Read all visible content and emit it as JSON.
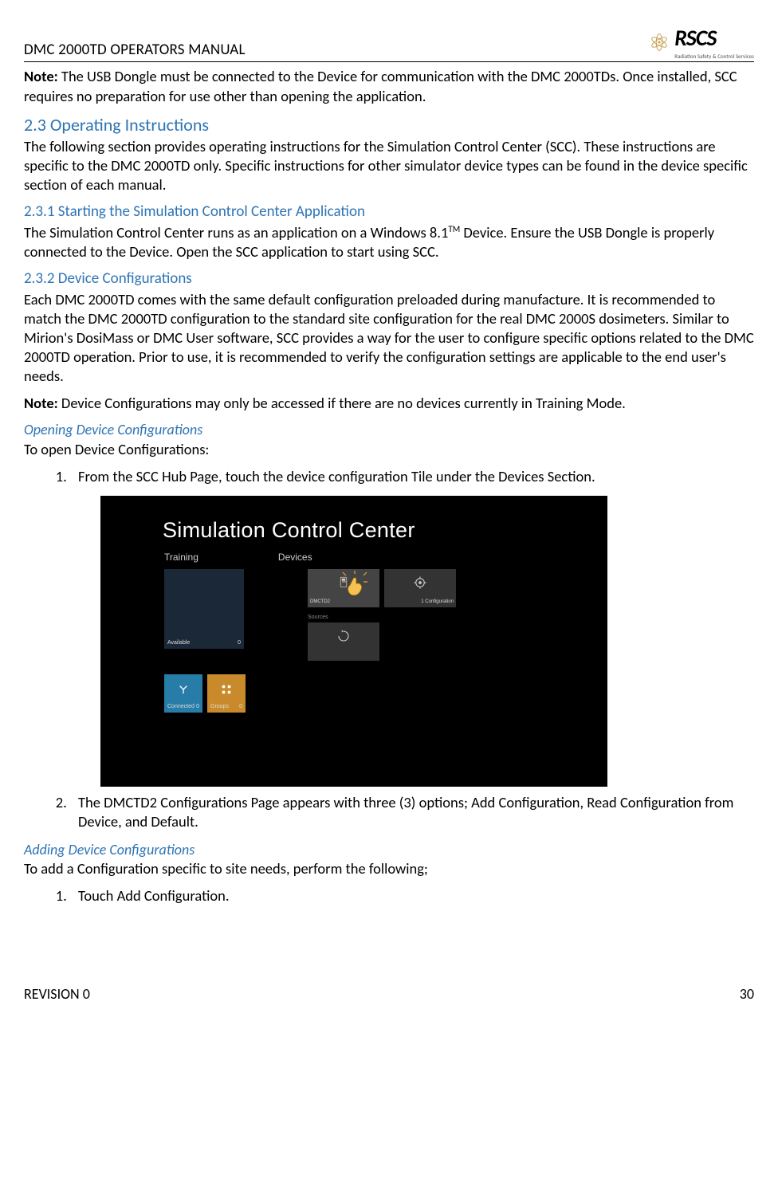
{
  "header": {
    "doc_title": "DMC 2000TD OPERATORS MANUAL",
    "logo_text": "RSCS",
    "logo_sub": "Radiation Safety & Control Services"
  },
  "body": {
    "note1_label": "Note:",
    "note1_text": " The USB Dongle must be connected to the Device for communication with the DMC 2000TDs. Once installed, SCC requires no preparation for use other than opening the application.",
    "h2_3": "2.3 Operating Instructions",
    "p2_3": "The following section provides operating instructions for the Simulation Control Center (SCC). These instructions are specific to the DMC 2000TD only. Specific instructions for other simulator device types can be found in the device specific section of each manual.",
    "h2_3_1": "2.3.1 Starting the Simulation Control Center Application",
    "p2_3_1a": "The Simulation Control Center runs as an application on a Windows 8.1",
    "p2_3_1_sup": "TM",
    "p2_3_1b": " Device. Ensure the USB Dongle is properly connected to the Device. Open the SCC application to start using SCC.",
    "h2_3_2": "2.3.2 Device Configurations",
    "p2_3_2": "Each DMC 2000TD comes with the same default configuration preloaded during manufacture. It is recommended to match the DMC 2000TD configuration to the standard site configuration for the real DMC 2000S dosimeters. Similar to Mirion's DosiMass or DMC User software, SCC provides a way for the user to configure specific options related to the DMC 2000TD operation. Prior to use, it is recommended to verify the configuration settings are applicable to the end user's needs.",
    "note2_label": "Note:",
    "note2_text": " Device Configurations may only be accessed if there are no devices currently in Training Mode.",
    "h_open_dc": "Opening Device Configurations",
    "p_open_dc": "To open Device Configurations:",
    "ol1_item1": "From the SCC Hub Page, touch the device configuration Tile under the Devices Section.",
    "ol1_item2": "The DMCTD2 Configurations Page appears with three (3) options; Add Configuration, Read Configuration from Device, and Default.",
    "h_add_dc": "Adding Device Configurations",
    "p_add_dc": "To add a Configuration specific to site needs, perform the following;",
    "ol2_item1": "Touch Add Configuration."
  },
  "screenshot": {
    "title": "Simulation Control Center",
    "section_training": "Training",
    "section_devices": "Devices",
    "tile_available": "Available",
    "tile_available_count": "0",
    "tile_connected": "Connected",
    "tile_connected_count": "0",
    "tile_groups": "Groups",
    "tile_groups_count": "0",
    "dev_tile_name": "DMCTD2",
    "dev_tile_count": "1 Configuration",
    "sources_label": "Sources"
  },
  "footer": {
    "revision": "REVISION 0",
    "page_number": "30"
  }
}
